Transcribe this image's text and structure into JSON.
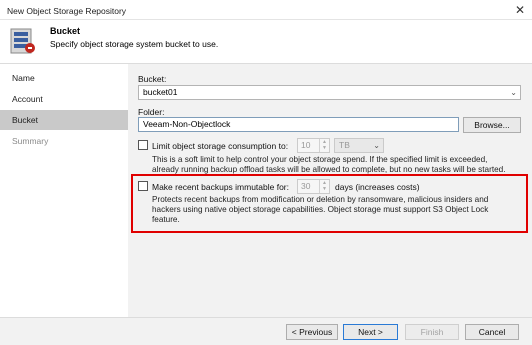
{
  "window": {
    "title": "New Object Storage Repository",
    "close_glyph": "✕"
  },
  "header": {
    "title": "Bucket",
    "subtitle": "Specify object storage system bucket to use.",
    "logo_icon": "object-storage-repository-icon"
  },
  "sidebar": {
    "items": [
      {
        "label": "Name",
        "state": "normal"
      },
      {
        "label": "Account",
        "state": "normal"
      },
      {
        "label": "Bucket",
        "state": "active"
      },
      {
        "label": "Summary",
        "state": "disabled"
      }
    ]
  },
  "form": {
    "bucket_label": "Bucket:",
    "bucket_value": "bucket01",
    "folder_label": "Folder:",
    "folder_value": "Veeam-Non-Objectlock",
    "browse_label": "Browse...",
    "limit_label": "Limit object storage consumption to:",
    "limit_checked": false,
    "limit_value": "10",
    "limit_unit": "TB",
    "limit_desc_1": "This is a soft limit to help control your object storage spend. If the specified limit is exceeded,",
    "limit_desc_2": "already running backup offload tasks will be allowed to complete, but no new tasks will be started.",
    "immutable_label": "Make recent backups immutable for:",
    "immutable_checked": false,
    "immutable_value": "30",
    "immutable_suffix": "days (increases costs)",
    "immutable_desc_1": "Protects recent backups from modification or deletion by ransomware, malicious insiders and",
    "immutable_desc_2": "hackers using native object storage capabilities. Object storage must support S3 Object Lock",
    "immutable_desc_3": "feature."
  },
  "footer": {
    "previous_label": "< Previous",
    "next_label": "Next >",
    "finish_label": "Finish",
    "cancel_label": "Cancel"
  },
  "colors": {
    "highlight_border": "#e00000",
    "active_nav": "#c9c9c9",
    "content_bg": "#f2f2f2"
  }
}
